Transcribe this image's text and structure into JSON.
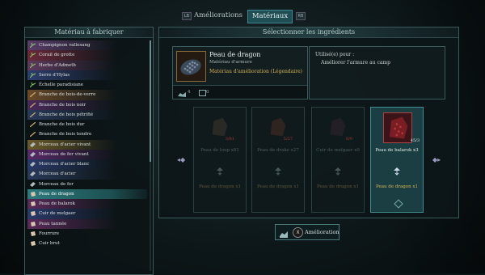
{
  "tabs": {
    "left_key": "LB",
    "right_key": "RB",
    "items": [
      {
        "label": "Améliorations"
      },
      {
        "label": "Matériaux"
      }
    ]
  },
  "left_panel": {
    "title": "Matériau à fabriquer",
    "items": [
      {
        "label": "Champignon vallesang",
        "icon": "plant-icon",
        "color": "#8fd06a",
        "stripe": "#5a3d6a"
      },
      {
        "label": "Corail de grotte",
        "icon": "plant-icon",
        "color": "#8fd06a",
        "stripe": "#6a2a3a"
      },
      {
        "label": "Herbe d'Admeth",
        "icon": "plant-icon",
        "color": "#8fd06a",
        "stripe": "#5e3a5e"
      },
      {
        "label": "Serre d'Hylas",
        "icon": "plant-icon",
        "color": "#8fd06a",
        "stripe": "#2e3e6e"
      },
      {
        "label": "Échelle paradisiane",
        "icon": "plant-icon",
        "color": "#8fd06a",
        "stripe": ""
      },
      {
        "label": "Branche de bois-de-verre",
        "icon": "branch-icon",
        "color": "#c7a86a",
        "stripe": "#6a4a2a"
      },
      {
        "label": "Branche de bois noir",
        "icon": "branch-icon",
        "color": "#c7a86a",
        "stripe": "#4a2a5a"
      },
      {
        "label": "Branche de bois pétrifié",
        "icon": "branch-icon",
        "color": "#c7a86a",
        "stripe": "#2a3a5a"
      },
      {
        "label": "Branche de bois dur",
        "icon": "branch-icon",
        "color": "#c7a86a",
        "stripe": ""
      },
      {
        "label": "Branche de bois tendre",
        "icon": "branch-icon",
        "color": "#c7a86a",
        "stripe": ""
      },
      {
        "label": "Morceau d'acier vivant",
        "icon": "metal-icon",
        "color": "#b0bcc0",
        "stripe": "#6a5a2a"
      },
      {
        "label": "Morceau de fer vivant",
        "icon": "metal-icon",
        "color": "#b0bcc0",
        "stripe": "#5a2a6a"
      },
      {
        "label": "Morceau d'acier blanc",
        "icon": "metal-icon",
        "color": "#b0bcc0",
        "stripe": "#2a3a6a"
      },
      {
        "label": "Morceau d'acier",
        "icon": "metal-icon",
        "color": "#b0bcc0",
        "stripe": "#2a3a5a"
      },
      {
        "label": "Morceau de fer",
        "icon": "metal-icon",
        "color": "#b0bcc0",
        "stripe": ""
      },
      {
        "label": "Peau de dragon",
        "icon": "hide-icon",
        "color": "#d8c8b0",
        "stripe": "",
        "selected": true
      },
      {
        "label": "Peau de balarok",
        "icon": "hide-icon",
        "color": "#d8c8b0",
        "stripe": "#5a2a5a"
      },
      {
        "label": "Cuir de melgaer",
        "icon": "hide-icon",
        "color": "#d8c8b0",
        "stripe": "#2a3a6a"
      },
      {
        "label": "Peau tannée",
        "icon": "hide-icon",
        "color": "#d8c8b0",
        "stripe": "#5a2a5a"
      },
      {
        "label": "Fourrure",
        "icon": "hide-icon",
        "color": "#d8c8b0",
        "stripe": ""
      },
      {
        "label": "Cuir brut",
        "icon": "hide-icon",
        "color": "#d8c8b0",
        "stripe": ""
      }
    ]
  },
  "right_panel": {
    "title": "Sélectionner les ingrédients",
    "material": {
      "name": "Peau de dragon",
      "type": "Matériau d'armure",
      "rarity": "Matériau d'amélioration (Légendaire)",
      "owned_count": "4",
      "crafted_count": "0"
    },
    "usage": {
      "label": "Utilisé(e) pour :",
      "value": "Améliorer l'armure au camp"
    },
    "recipes": [
      {
        "ingredient": "Peau de loup x81",
        "count": "3/81",
        "result": "Peau de dragon x1",
        "color": "#5a4a30",
        "active": false
      },
      {
        "ingredient": "Peau de drake x27",
        "count": "5/27",
        "result": "Peau de dragon x1",
        "color": "#6a3a24",
        "active": false
      },
      {
        "ingredient": "Cuir de melgaer x9",
        "count": "6/9",
        "result": "Peau de dragon x1",
        "color": "#4a2a3a",
        "active": false
      },
      {
        "ingredient": "Peau de balarok x3",
        "count": "45/3",
        "result": "Peau de dragon x1",
        "color": "#7a1e24",
        "active": true
      }
    ]
  },
  "confirm": {
    "button": "X",
    "label": "Amélioration"
  },
  "colors": {
    "accent": "#3f8892",
    "legendary": "#d9b25a"
  }
}
